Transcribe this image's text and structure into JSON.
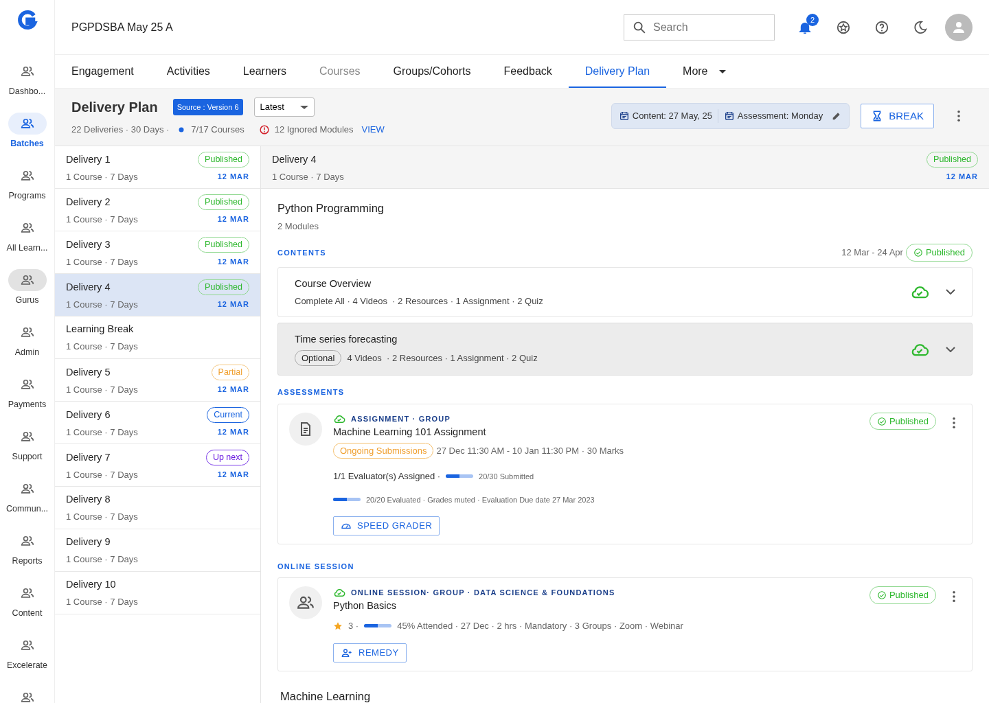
{
  "sidebar": {
    "items": [
      {
        "label": "Dashbo...",
        "selected": false,
        "hovered": false
      },
      {
        "label": "Batches",
        "selected": true,
        "hovered": false
      },
      {
        "label": "Programs",
        "selected": false,
        "hovered": false
      },
      {
        "label": "All Learn...",
        "selected": false,
        "hovered": false
      },
      {
        "label": "Gurus",
        "selected": false,
        "hovered": true
      },
      {
        "label": "Admin",
        "selected": false,
        "hovered": false
      },
      {
        "label": "Payments",
        "selected": false,
        "hovered": false
      },
      {
        "label": "Support",
        "selected": false,
        "hovered": false
      },
      {
        "label": "Commun...",
        "selected": false,
        "hovered": false
      },
      {
        "label": "Reports",
        "selected": false,
        "hovered": false
      },
      {
        "label": "Content",
        "selected": false,
        "hovered": false
      },
      {
        "label": "Excelerate",
        "selected": false,
        "hovered": false
      },
      {
        "selected": false,
        "hovered": false
      }
    ]
  },
  "topbar": {
    "title": "PGPDSBA May 25 A",
    "search": {
      "placeholder": "Search"
    },
    "notifications": "2"
  },
  "tabs": [
    {
      "label": "Engagement",
      "selected": false,
      "disabled": false
    },
    {
      "label": "Activities",
      "selected": false,
      "disabled": false
    },
    {
      "label": "Learners",
      "selected": false,
      "disabled": false
    },
    {
      "label": "Courses",
      "selected": false,
      "disabled": true
    },
    {
      "label": "Groups/Cohorts",
      "selected": false,
      "disabled": false
    },
    {
      "label": "Feedback",
      "selected": false,
      "disabled": false
    },
    {
      "label": "Delivery Plan",
      "selected": true,
      "disabled": false
    },
    {
      "label": "More",
      "selected": false,
      "disabled": false,
      "kind": "menu"
    }
  ],
  "header": {
    "title": "Delivery Plan",
    "source": "Source : Version 6",
    "version": "Latest",
    "summary": "22 Deliveries · 30 Days ·",
    "courses": "7/17 Courses",
    "ignored": "12 Ignored Modules",
    "view": "VIEW",
    "content_date": "Content: 27 May, 25",
    "assessment_day": "Assessment: Monday",
    "break": "BREAK"
  },
  "deliveries": [
    {
      "title": "Delivery 1",
      "meta": "1 Course · 7 Days",
      "status": "Published",
      "kind": "published",
      "date": "12 MAR",
      "selected": false
    },
    {
      "title": "Delivery 2",
      "meta": "1 Course · 7 Days",
      "status": "Published",
      "kind": "published",
      "date": "12 MAR",
      "selected": false
    },
    {
      "title": "Delivery 3",
      "meta": "1 Course · 7 Days",
      "status": "Published",
      "kind": "published",
      "date": "12 MAR",
      "selected": false
    },
    {
      "title": "Delivery 4",
      "meta": "1 Course · 7 Days",
      "status": "Published",
      "kind": "published",
      "date": "12 MAR",
      "selected": true
    },
    {
      "title": "Learning Break",
      "meta": "1 Course · 7 Days",
      "selected": false
    },
    {
      "title": "Delivery 5",
      "meta": "1 Course · 7 Days",
      "status": "Partial",
      "kind": "partial",
      "date": "12 MAR",
      "selected": false
    },
    {
      "title": "Delivery 6",
      "meta": "1 Course · 7 Days",
      "status": "Current",
      "kind": "current",
      "date": "12 MAR",
      "selected": false
    },
    {
      "title": "Delivery 7",
      "meta": "1 Course · 7 Days",
      "status": "Up next",
      "kind": "upnext",
      "date": "12 MAR",
      "selected": false
    },
    {
      "title": "Delivery 8",
      "meta": "1 Course · 7 Days",
      "selected": false
    },
    {
      "title": "Delivery 9",
      "meta": "1 Course · 7 Days",
      "selected": false
    },
    {
      "title": "Delivery 10",
      "meta": "1 Course · 7 Days",
      "selected": false
    }
  ],
  "detail": {
    "title": "Delivery 4",
    "meta": "1 Course · 7 Days",
    "status": "Published",
    "date": "12 MAR",
    "course": {
      "title": "Python Programming",
      "meta": "2 Modules"
    },
    "contents": {
      "heading": "CONTENTS",
      "range": "12 Mar - 24 Apr",
      "status": "Published",
      "modules": [
        {
          "title": "Course Overview",
          "meta": "Complete All · 4 Videos  · 2 Resources · 1 Assignment · 2 Quiz",
          "shaded": false
        },
        {
          "title": "Time series forecasting",
          "tag": "Optional",
          "meta": "4 Videos  · 2 Resources · 1 Assignment · 2 Quiz",
          "shaded": true
        }
      ]
    },
    "assessments": {
      "heading": "ASSESSMENTS",
      "items": [
        {
          "type": "ASSIGNMENT · GROUP",
          "title": "Machine Learning 101 Assignment",
          "status": "Published",
          "tag": "Ongoing Submissions",
          "schedule": "27 Dec 11:30 AM - 10 Jan 11:30 PM · 30 Marks",
          "evaluators": "1/1 Evaluator(s) Assigned ·",
          "submitted": {
            "level": 0.5,
            "text": "20/30 Submitted"
          },
          "evaluated": {
            "level": 0.5,
            "text": "20/20 Evaluated · Grades muted · Evaluation Due date 27 Mar 2023"
          },
          "action": "SPEED GRADER"
        }
      ]
    },
    "sessions": {
      "heading": "ONLINE SESSION",
      "items": [
        {
          "type": "ONLINE SESSION· GROUP · DATA SCIENCE & FOUNDATIONS",
          "title": "Python Basics",
          "status": "Published",
          "rating": "3 ·",
          "attendance": {
            "level": 0.5
          },
          "details": "45% Attended · 27 Dec · 2 hrs · Mandatory · 3 Groups · Zoom · Webinar",
          "action": "REMEDY"
        }
      ]
    },
    "next_course": {
      "title": "Machine Learning"
    }
  }
}
